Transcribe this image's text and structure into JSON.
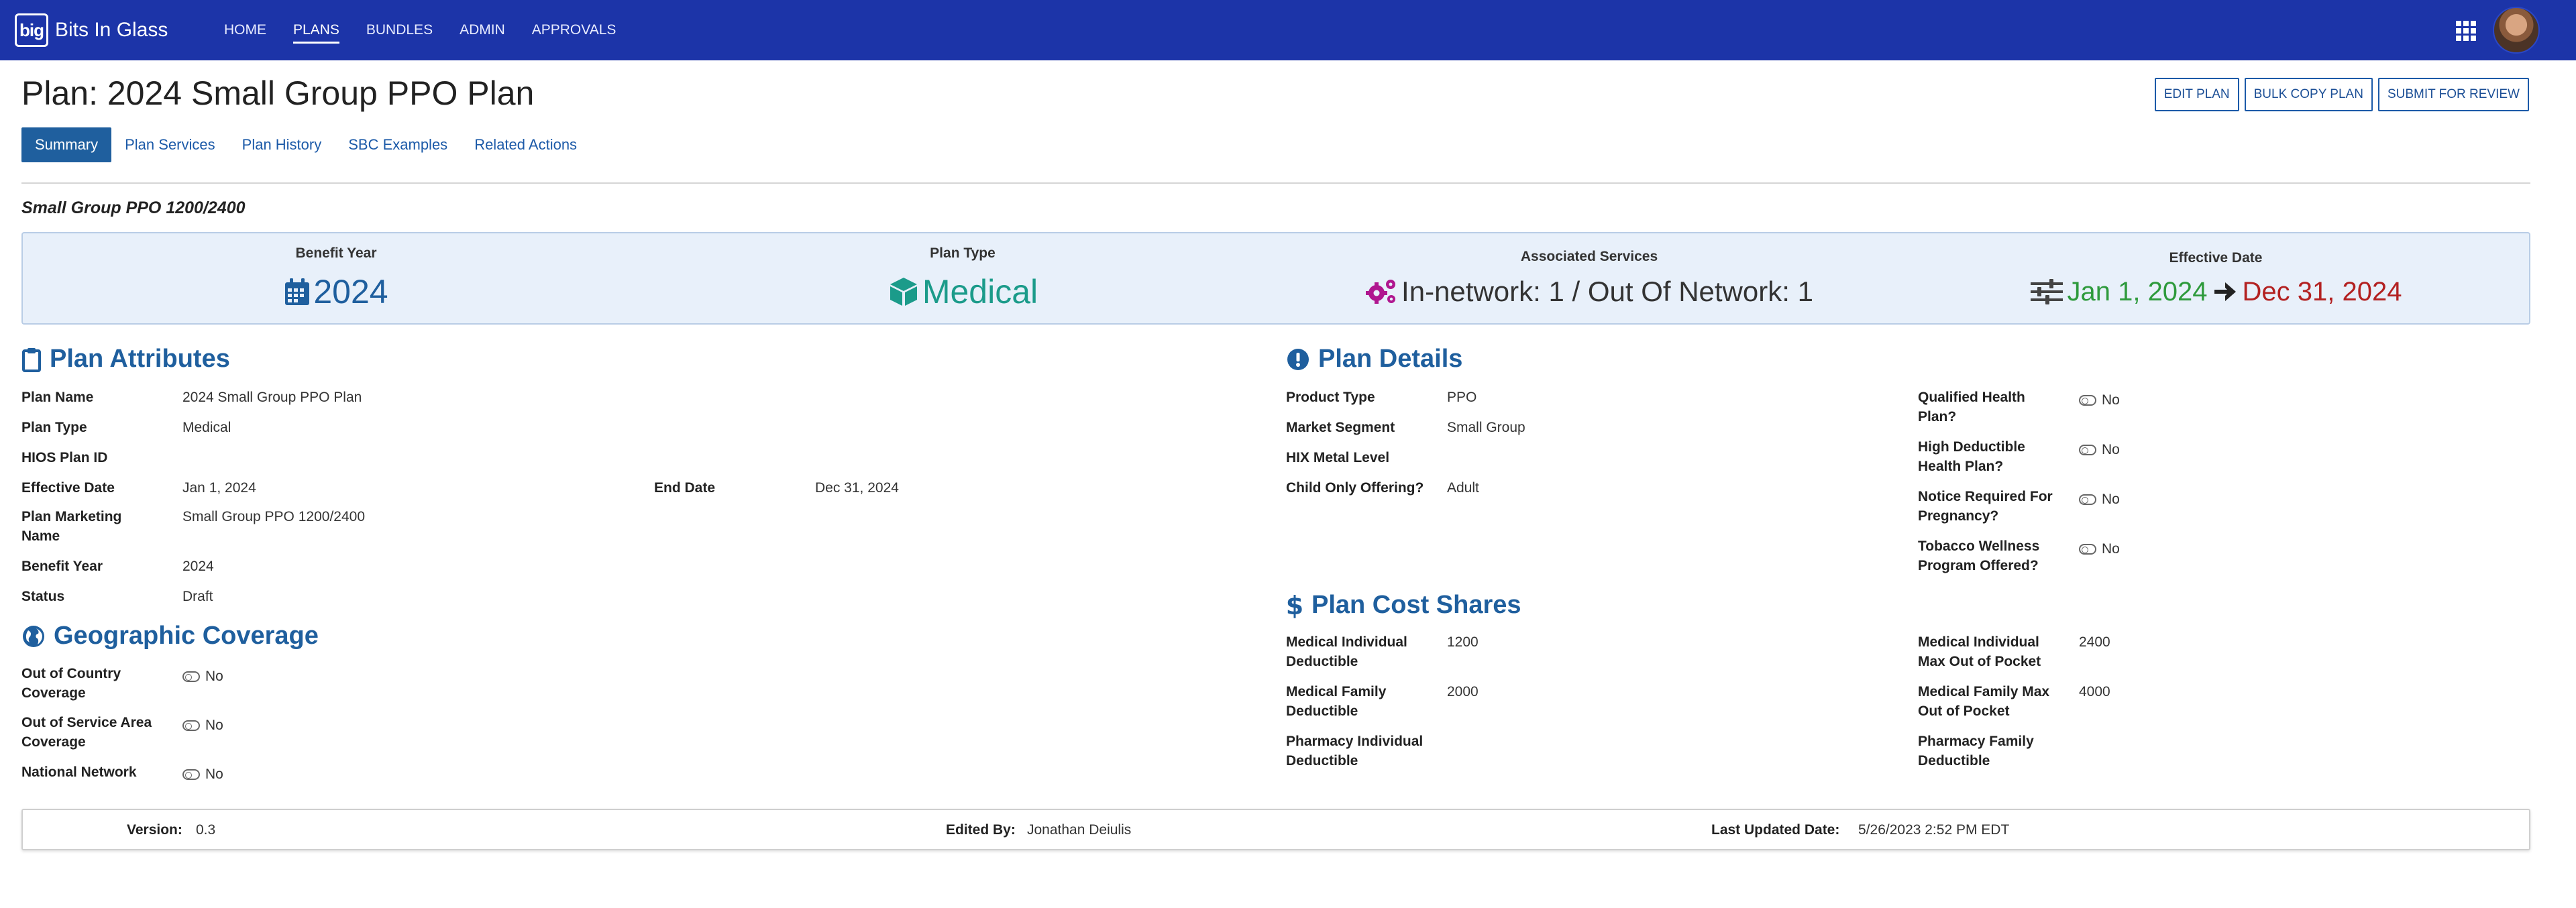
{
  "app": {
    "logo_mark": "big",
    "name": "Bits In Glass"
  },
  "nav": {
    "items": [
      {
        "label": "HOME"
      },
      {
        "label": "PLANS"
      },
      {
        "label": "BUNDLES"
      },
      {
        "label": "ADMIN"
      },
      {
        "label": "APPROVALS"
      }
    ],
    "active": "PLANS"
  },
  "header": {
    "title": "Plan: 2024 Small Group PPO Plan",
    "actions": {
      "edit": "EDIT PLAN",
      "bulk_copy": "BULK COPY PLAN",
      "submit": "SUBMIT FOR REVIEW"
    }
  },
  "tabs": [
    {
      "label": "Summary"
    },
    {
      "label": "Plan Services"
    },
    {
      "label": "Plan History"
    },
    {
      "label": "SBC Examples"
    },
    {
      "label": "Related Actions"
    }
  ],
  "subtitle": "Small Group PPO 1200/2400",
  "highlights": {
    "benefit_year": {
      "label": "Benefit Year",
      "value": "2024",
      "icon": "calendar-icon"
    },
    "plan_type": {
      "label": "Plan Type",
      "value": "Medical",
      "icon": "cube-icon"
    },
    "services": {
      "label": "Associated Services",
      "value": "In-network: 1 / Out Of Network: 1",
      "icon": "gears-icon"
    },
    "effective": {
      "label": "Effective Date",
      "start": "Jan 1, 2024",
      "end": "Dec 31, 2024",
      "icon": "sliders-icon"
    }
  },
  "colors": {
    "nav_bg": "#1c34a8",
    "accent": "#1f5f9e",
    "teal": "#1b9b8a",
    "magenta": "#b0168f",
    "green": "#2e9a3c",
    "red": "#b32121"
  },
  "plan_attributes": {
    "heading": "Plan Attributes",
    "plan_name_label": "Plan Name",
    "plan_name": "2024 Small Group PPO Plan",
    "plan_type_label": "Plan Type",
    "plan_type": "Medical",
    "hios_label": "HIOS Plan ID",
    "hios": "",
    "effective_label": "Effective Date",
    "effective": "Jan 1, 2024",
    "end_label": "End Date",
    "end": "Dec 31, 2024",
    "marketing_label_1": "Plan Marketing",
    "marketing_label_2": "Name",
    "marketing": "Small Group PPO 1200/2400",
    "benefit_year_label": "Benefit Year",
    "benefit_year": "2024",
    "status_label": "Status",
    "status": "Draft"
  },
  "geo": {
    "heading": "Geographic Coverage",
    "out_country_label_1": "Out of Country",
    "out_country_label_2": "Coverage",
    "out_country": "No",
    "out_area_label_1": "Out of Service Area",
    "out_area_label_2": "Coverage",
    "out_area": "No",
    "national_label": "National Network",
    "national": "No"
  },
  "plan_details": {
    "heading": "Plan Details",
    "product_type_label": "Product Type",
    "product_type": "PPO",
    "market_label": "Market Segment",
    "market": "Small Group",
    "hix_label": "HIX Metal Level",
    "hix": "",
    "child_label": "Child Only Offering?",
    "child": "Adult",
    "qhp_label_1": "Qualified Health",
    "qhp_label_2": "Plan?",
    "qhp": "No",
    "hdhp_label_1": "High Deductible",
    "hdhp_label_2": "Health Plan?",
    "hdhp": "No",
    "notice_label_1": "Notice Required For",
    "notice_label_2": "Pregnancy?",
    "notice": "No",
    "tobacco_label_1": "Tobacco Wellness",
    "tobacco_label_2": "Program Offered?",
    "tobacco": "No"
  },
  "cost_shares": {
    "heading": "Plan Cost Shares",
    "med_ind_ded_label_1": "Medical Individual",
    "med_ind_ded_label_2": "Deductible",
    "med_ind_ded": "1200",
    "med_fam_ded_label_1": "Medical Family",
    "med_fam_ded_label_2": "Deductible",
    "med_fam_ded": "2000",
    "pharm_ind_ded_label_1": "Pharmacy Individual",
    "pharm_ind_ded_label_2": "Deductible",
    "pharm_ind_ded": "",
    "med_ind_moop_label_1": "Medical Individual",
    "med_ind_moop_label_2": "Max Out of Pocket",
    "med_ind_moop": "2400",
    "med_fam_moop_label_1": "Medical Family Max",
    "med_fam_moop_label_2": "Out of Pocket",
    "med_fam_moop": "4000",
    "pharm_fam_ded_label_1": "Pharmacy Family",
    "pharm_fam_ded_label_2": "Deductible",
    "pharm_fam_ded": ""
  },
  "footer": {
    "version_label": "Version:",
    "version": "0.3",
    "edited_label": "Edited By:",
    "edited": "Jonathan Deiulis",
    "updated_label": "Last Updated Date:",
    "updated": "5/26/2023 2:52 PM EDT"
  }
}
